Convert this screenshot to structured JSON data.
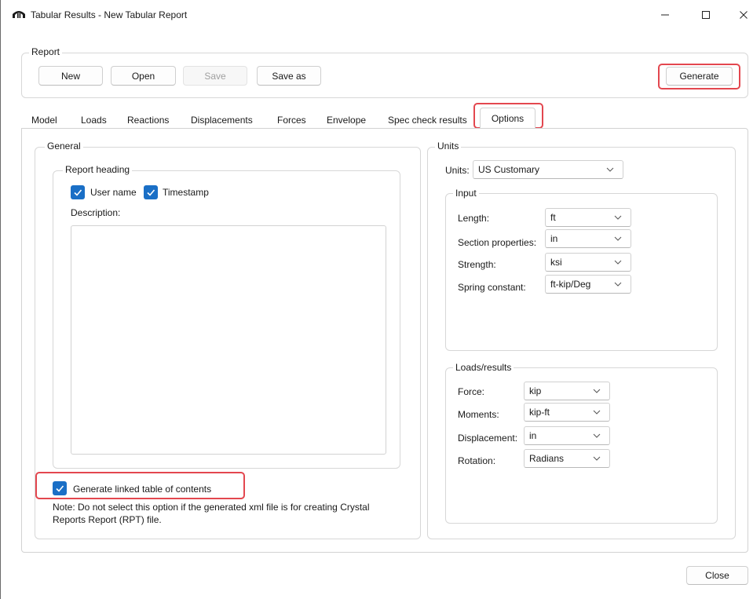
{
  "window": {
    "title": "Tabular Results - New Tabular Report",
    "minimize_glyph": "—",
    "maximize_glyph": "☐",
    "close_glyph": "✕"
  },
  "report": {
    "legend": "Report",
    "new_label": "New",
    "open_label": "Open",
    "save_label": "Save",
    "save_as_label": "Save as",
    "generate_label": "Generate"
  },
  "tabs": {
    "model": "Model",
    "loads": "Loads",
    "reactions": "Reactions",
    "displacements": "Displacements",
    "forces": "Forces",
    "envelope": "Envelope",
    "spec_check": "Spec check results",
    "options": "Options"
  },
  "general": {
    "legend": "General",
    "report_heading_legend": "Report heading",
    "user_name_label": "User name",
    "timestamp_label": "Timestamp",
    "description_label": "Description:",
    "description_value": "",
    "linked_toc_label": "Generate linked table of contents",
    "note_line1": "Note: Do not select this option if the generated xml file is for creating Crystal",
    "note_line2": "Reports Report (RPT) file."
  },
  "units": {
    "legend": "Units",
    "units_label": "Units:",
    "units_value": "US Customary",
    "input": {
      "legend": "Input",
      "length_label": "Length:",
      "length_value": "ft",
      "section_label": "Section properties:",
      "section_value": "in",
      "strength_label": "Strength:",
      "strength_value": "ksi",
      "spring_label": "Spring constant:",
      "spring_value": "ft-kip/Deg"
    },
    "loads": {
      "legend": "Loads/results",
      "force_label": "Force:",
      "force_value": "kip",
      "moments_label": "Moments:",
      "moments_value": "kip-ft",
      "displacement_label": "Displacement:",
      "displacement_value": "in",
      "rotation_label": "Rotation:",
      "rotation_value": "Radians"
    }
  },
  "footer": {
    "close_label": "Close"
  },
  "colors": {
    "accent": "#1a6fc6",
    "highlight": "#e3474f"
  }
}
